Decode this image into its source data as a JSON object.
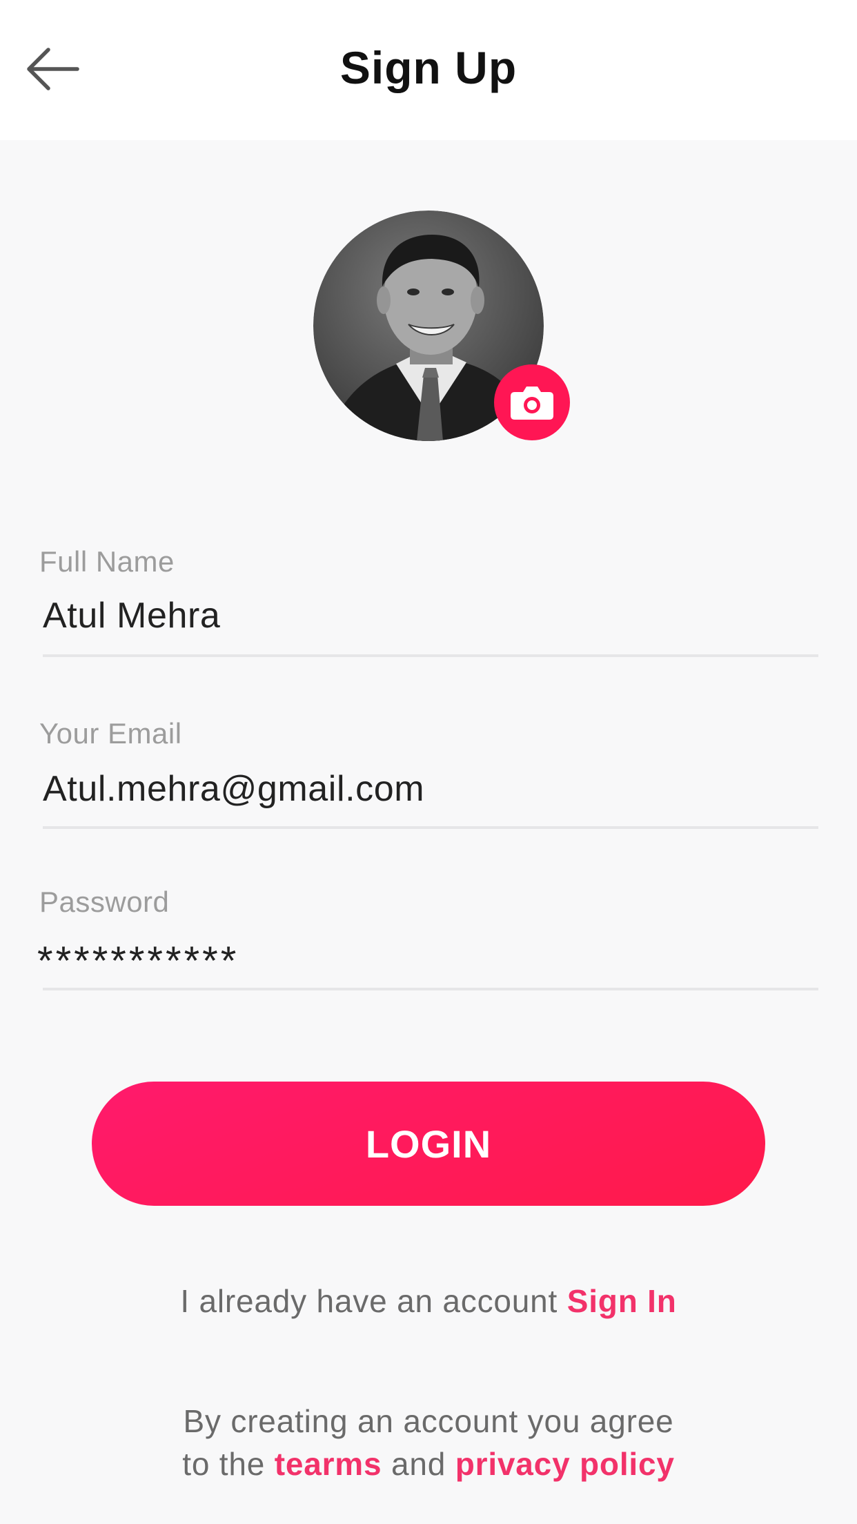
{
  "header": {
    "title": "Sign Up",
    "back_icon": "arrow-left-icon"
  },
  "profile": {
    "avatar_icon": "profile-photo",
    "camera_icon": "camera-icon",
    "camera_color": "#ff1654"
  },
  "form": {
    "full_name": {
      "label": "Full Name",
      "value": "Atul Mehra"
    },
    "email": {
      "label": "Your Email",
      "value": "Atul.mehra@gmail.com"
    },
    "password": {
      "label": "Password",
      "value": "***********"
    }
  },
  "login_button": {
    "label": "LOGIN",
    "color": "#ff1a5c"
  },
  "signin_prompt": {
    "text": "I already have an account",
    "link": "Sign In",
    "link_color": "#f2326a"
  },
  "terms": {
    "line1": "By creating an account you agree",
    "prefix": "to the",
    "terms_link": "tearms",
    "and": "and",
    "privacy_link": "privacy policy"
  }
}
